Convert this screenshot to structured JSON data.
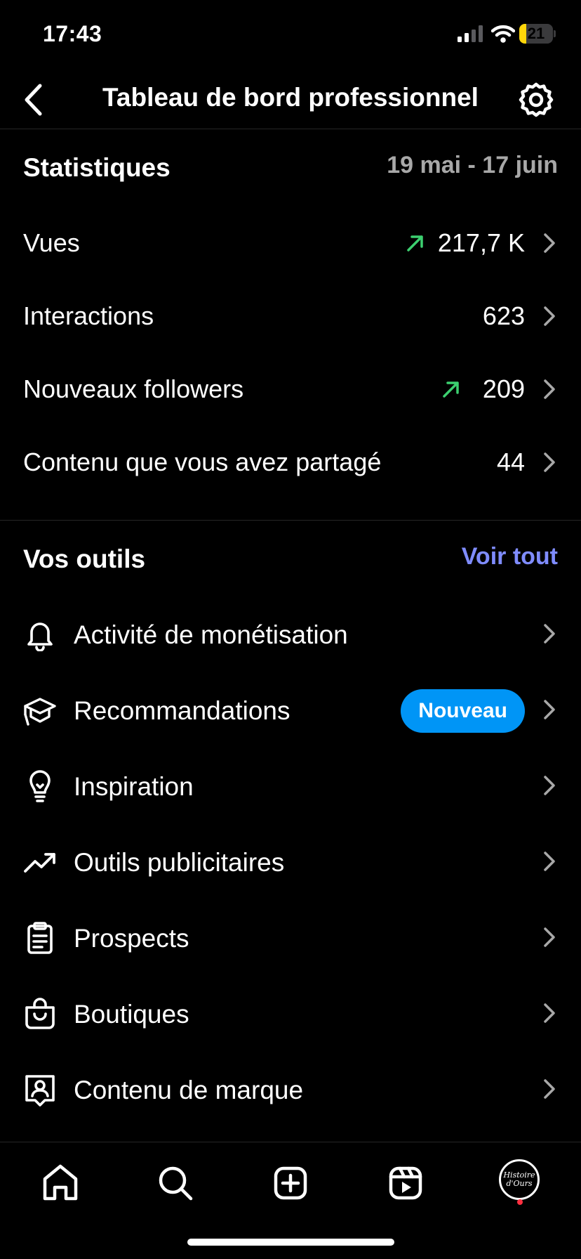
{
  "status_bar": {
    "time": "17:43",
    "battery": "21",
    "battery_level": 0.21
  },
  "header": {
    "title": "Tableau de bord professionnel"
  },
  "stats": {
    "title": "Statistiques",
    "date_range": "19 mai - 17 juin",
    "rows": [
      {
        "label": "Vues",
        "value": "217,7 K",
        "trend": "up"
      },
      {
        "label": "Interactions",
        "value": "623",
        "trend": ""
      },
      {
        "label": "Nouveaux followers",
        "value": "209",
        "trend": "up"
      },
      {
        "label": "Contenu que vous avez partagé",
        "value": "44",
        "trend": ""
      }
    ]
  },
  "tools": {
    "title": "Vos outils",
    "see_all": "Voir tout",
    "items": [
      {
        "label": "Activité de monétisation",
        "icon": "bell-icon"
      },
      {
        "label": "Recommandations",
        "icon": "graduation-cap-icon",
        "badge": "Nouveau"
      },
      {
        "label": "Inspiration",
        "icon": "lightbulb-icon"
      },
      {
        "label": "Outils publicitaires",
        "icon": "trending-up-icon"
      },
      {
        "label": "Prospects",
        "icon": "clipboard-icon"
      },
      {
        "label": "Boutiques",
        "icon": "shopping-bag-icon"
      },
      {
        "label": "Contenu de marque",
        "icon": "branded-content-icon"
      }
    ]
  },
  "avatar": {
    "text": "Histoire d'Ours"
  },
  "colors": {
    "accent_link": "#7f8cff",
    "badge": "#0095f6",
    "trend_up": "#3cd070",
    "notification_dot": "#ff3040"
  }
}
